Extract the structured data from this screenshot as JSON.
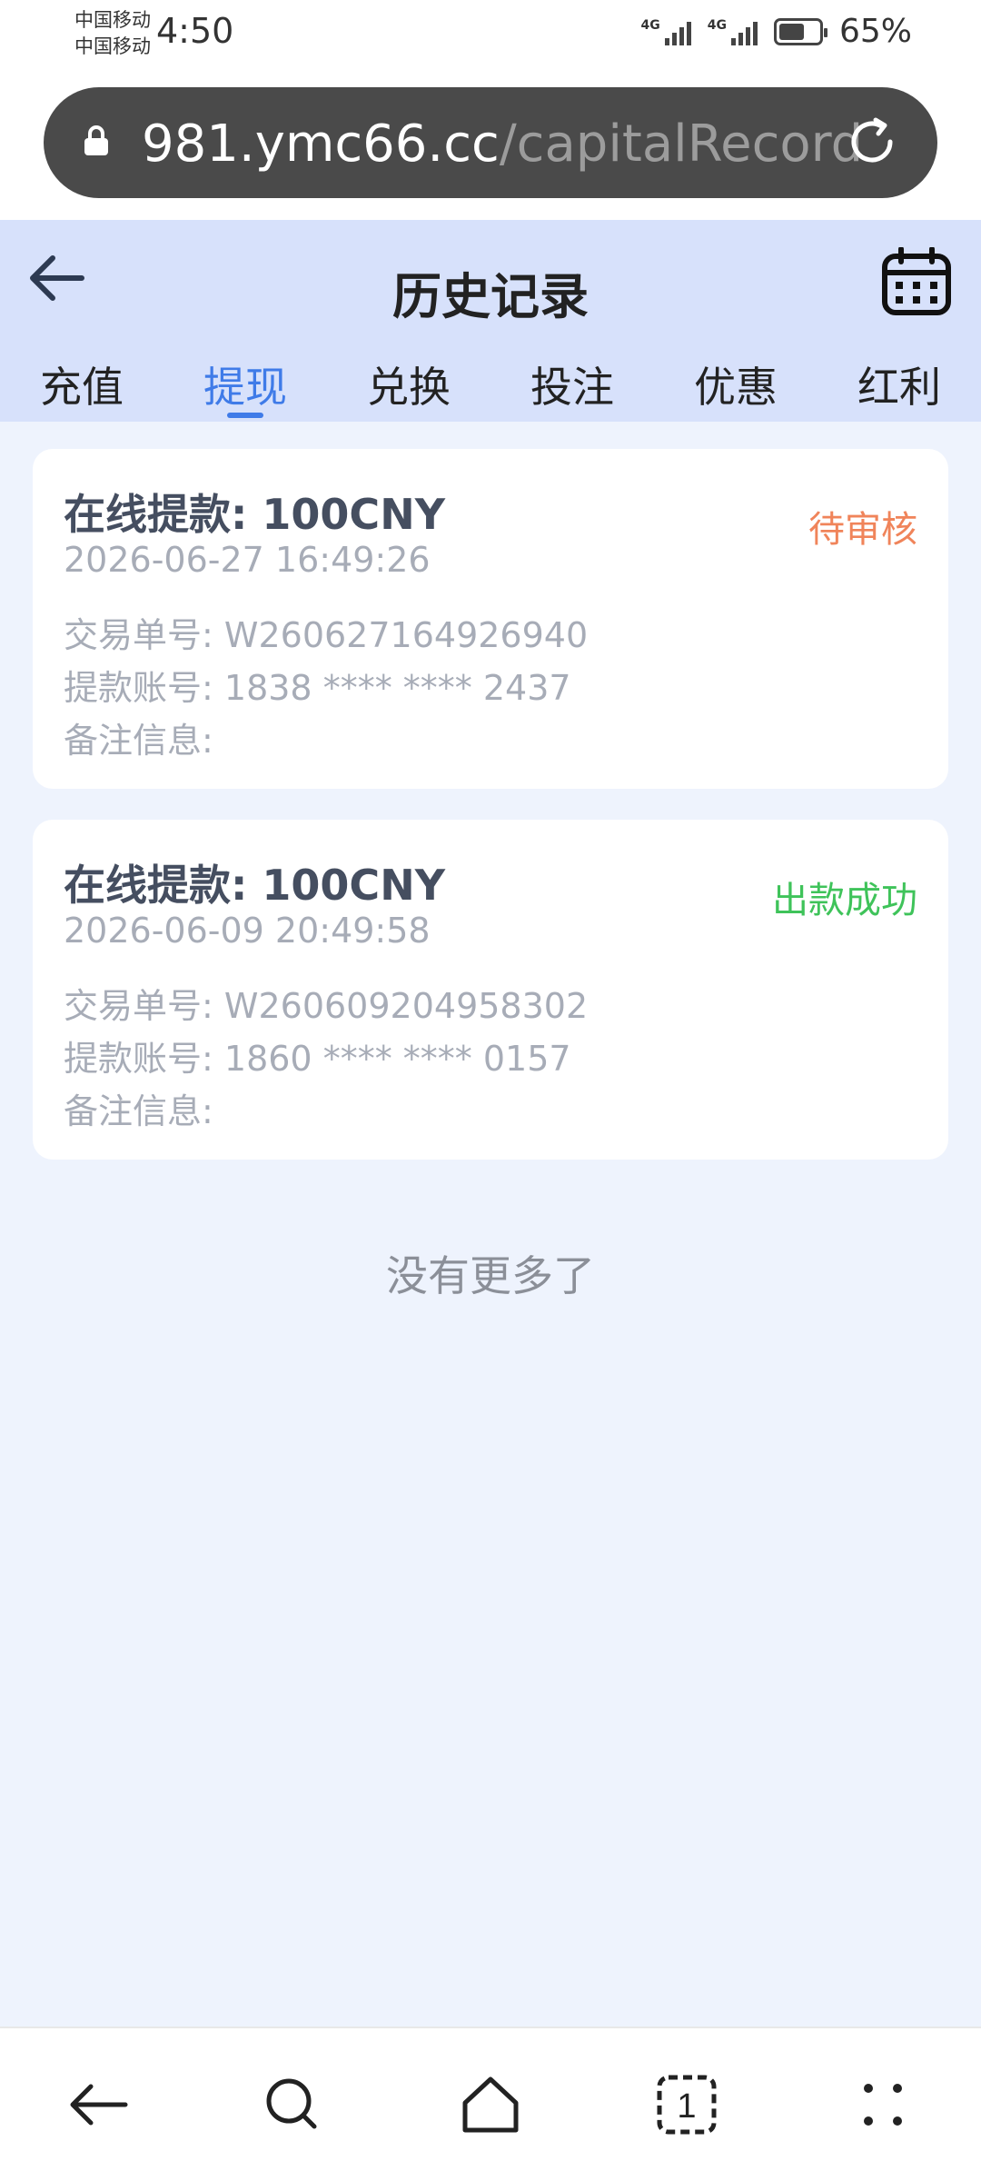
{
  "status_bar": {
    "carrier1": "中国移动",
    "carrier2": "中国移动",
    "time": "4:50",
    "network1": "4G",
    "network2": "4G",
    "battery": "65%",
    "battery_level": 0.65
  },
  "browser": {
    "url_host": "981.ymc66.cc",
    "url_path": "/capitalRecord"
  },
  "header": {
    "title": "历史记录"
  },
  "tabs": [
    {
      "label": "充值"
    },
    {
      "label": "提现"
    },
    {
      "label": "兑换"
    },
    {
      "label": "投注"
    },
    {
      "label": "优惠"
    },
    {
      "label": "红利"
    }
  ],
  "active_tab": "提现",
  "records": [
    {
      "title": "在线提款:  100CNY",
      "status": "待审核",
      "status_color": "#f0845a",
      "date": "2026-06-27 16:49:26",
      "tx_label": "交易单号:",
      "tx_value": "W260627164926940",
      "account_label": "提款账号:",
      "account_value": "1838 **** **** 2437",
      "note_label": "备注信息:"
    },
    {
      "title": "在线提款:  100CNY",
      "status": "出款成功",
      "status_color": "#3fc35a",
      "date": "2026-06-09 20:49:58",
      "tx_label": "交易单号:",
      "tx_value": "W260609204958302",
      "account_label": "提款账号:",
      "account_value": "1860 **** **** 0157",
      "note_label": "备注信息:"
    }
  ],
  "no_more": "没有更多了",
  "bottom_nav": {
    "tab_count": "1"
  },
  "colors": {
    "accent": "#3f7be8",
    "header_bg": "#d7e1fb",
    "page_bg": "#eef3fd"
  }
}
